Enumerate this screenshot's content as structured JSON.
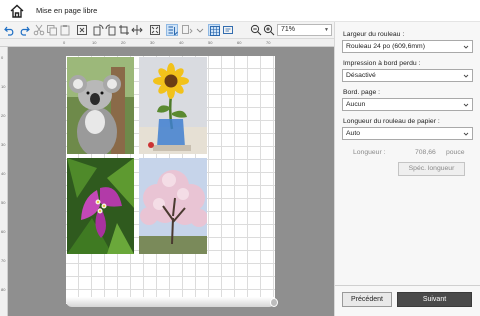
{
  "window": {
    "title": "Mise en page libre"
  },
  "toolbar": {
    "zoom": "71%",
    "buttons": [
      "undo-icon",
      "redo-icon",
      "cut-icon",
      "copy-icon",
      "paste-icon",
      "delete-icon",
      "rotate-icon",
      "crop-icon",
      "rotate-left-icon",
      "align-icon",
      "fit-icon",
      "layout-icon",
      "auto-layout-icon",
      "grid-icon",
      "caption-icon",
      "zoom-out-icon",
      "zoom-in-icon"
    ]
  },
  "ruler": {
    "h_labels": [
      "0",
      "10",
      "20",
      "30",
      "40",
      "50",
      "60",
      "70"
    ],
    "v_labels": [
      "0",
      "10",
      "20",
      "30",
      "40",
      "50",
      "60",
      "70",
      "80"
    ]
  },
  "canvas": {
    "photos": [
      "koala",
      "sunflower",
      "bougainvillea",
      "cherry-blossom-tree"
    ]
  },
  "panel": {
    "roll_width_label": "Largeur du rouleau :",
    "roll_width_value": "Rouleau 24 po (609,6mm)",
    "borderless_label": "Impression à bord perdu :",
    "borderless_value": "Désactivé",
    "page_edge_label": "Bord. page :",
    "page_edge_value": "Aucun",
    "paper_length_label": "Longueur du rouleau de papier :",
    "paper_length_value": "Auto",
    "length_label": "Longueur :",
    "length_value": "708,66",
    "length_unit": "pouce",
    "spec_length_button": "Spéc. longueur",
    "prev_button": "Précédent",
    "next_button": "Suivant"
  },
  "colors": {
    "accent": "#4a4a4a",
    "canvas_bg": "#8f8f8f",
    "toolbar_active": "#cfe3f7"
  }
}
